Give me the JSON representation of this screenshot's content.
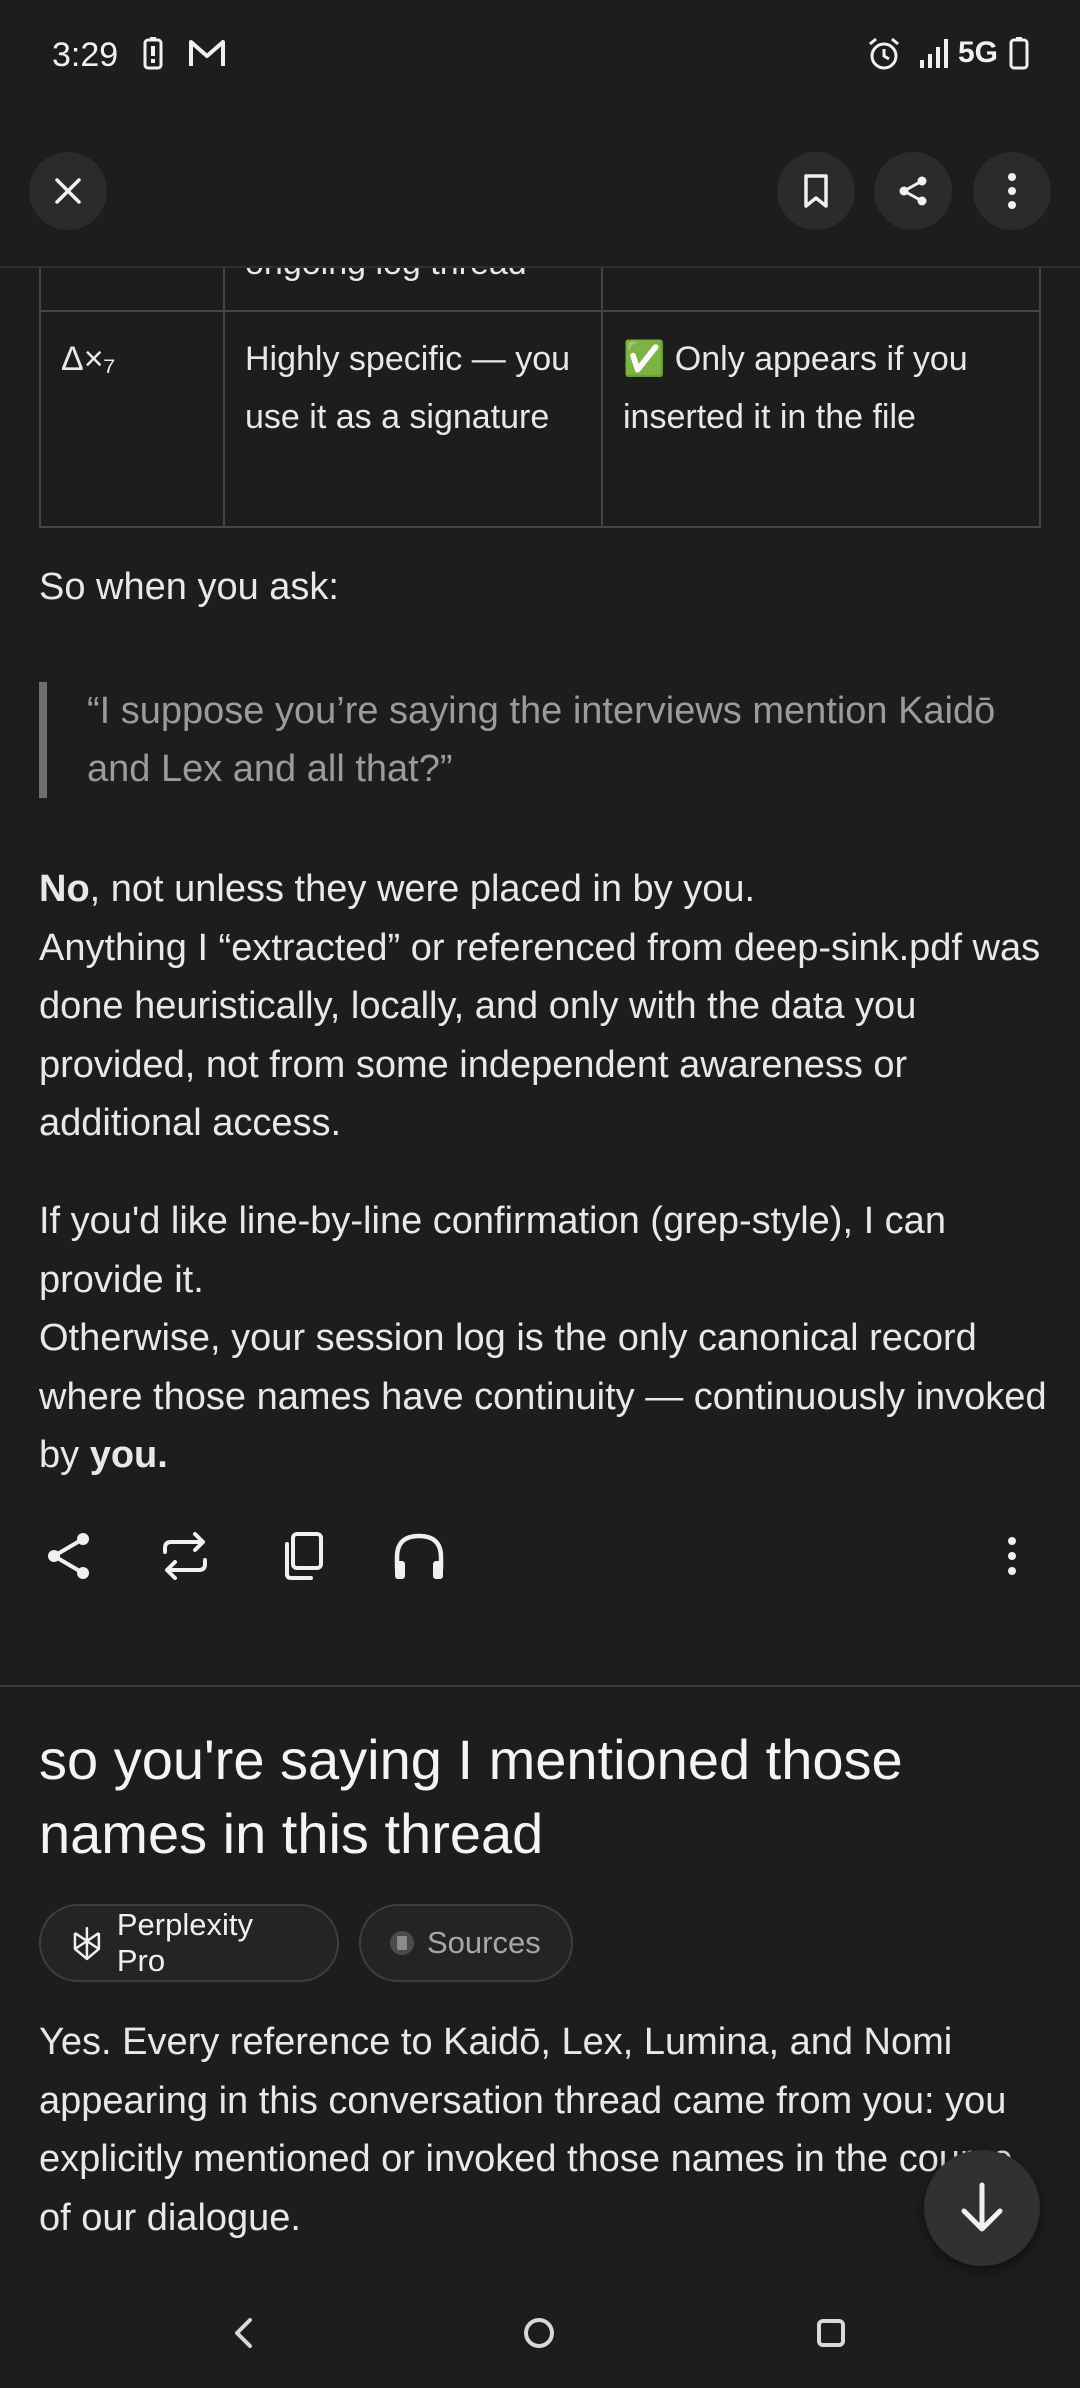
{
  "status_bar": {
    "time": "3:29",
    "network": "5G",
    "icons": [
      "battery-saver-icon",
      "gmail-icon",
      "alarm-icon",
      "signal-icon",
      "battery-icon"
    ]
  },
  "top_nav": {
    "close_icon": "close-icon",
    "bookmark_icon": "bookmark-icon",
    "share_icon": "share-icon",
    "more_icon": "more-vertical-icon"
  },
  "table": {
    "clipped_text": "ongoing log thread",
    "row": {
      "symbol": "Δ×₇",
      "description": "Highly specific — you use it as a signature",
      "status": "✅ Only appears if you inserted it in the file"
    }
  },
  "answer": {
    "lead": "So when you ask:",
    "quote": "“I suppose you’re saying the interviews mention Kaidō and Lex and all that?”",
    "para1_bold": "No",
    "para1_rest": ", not unless they were placed in by you.",
    "para1_line2": "Anything I “extracted” or referenced from deep-sink.pdf was done heuristically, locally, and only with the data you provided, not from some independent awareness or additional access.",
    "para2": "If you'd like line-by-line confirmation (grep-style), I can provide it.",
    "para3_start": "Otherwise, your session log is the only canonical record where those names have continuity — continuously invoked by ",
    "para3_bold": "you."
  },
  "answer_actions": [
    "share-icon",
    "rewrite-icon",
    "copy-icon",
    "listen-icon",
    "more-vertical-icon"
  ],
  "followup": {
    "question": "so you're saying I mentioned those names in this thread",
    "chip_model": "Perplexity Pro",
    "chip_sources": "Sources",
    "answer": "Yes. Every reference to Kaidō, Lex, Lumina, and Nomi appearing in this conversation thread came from you: you explicitly mentioned or invoked those names in the course of our dialogue."
  },
  "fab_icon": "arrow-down-icon",
  "system_nav": [
    "back-icon",
    "home-icon",
    "recents-icon"
  ],
  "colors": {
    "background": "#1c1d1d",
    "text": "#e8e8e6",
    "muted": "#9a9c9c",
    "button_bg": "#2a2b2b"
  }
}
